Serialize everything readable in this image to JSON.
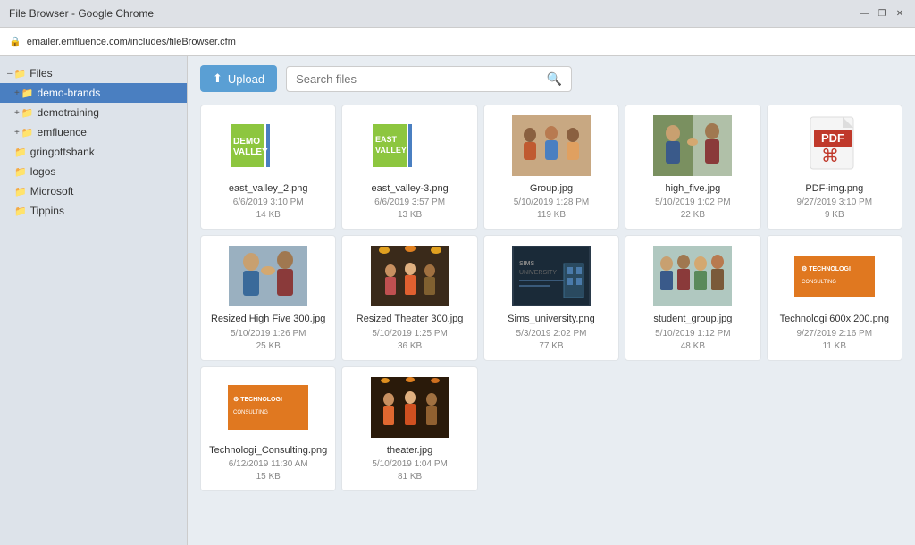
{
  "browser": {
    "title": "File Browser - Google Chrome",
    "url": "emailer.emfluence.com/includes/fileBrowser.cfm",
    "controls": {
      "minimize": "—",
      "maximize": "❐",
      "close": "✕"
    }
  },
  "toolbar": {
    "upload_label": "Upload",
    "search_placeholder": "Search files"
  },
  "sidebar": {
    "root_label": "Files",
    "items": [
      {
        "id": "demo-brands",
        "label": "demo-brands",
        "level": 1,
        "active": true,
        "expanded": false
      },
      {
        "id": "demotraining",
        "label": "demotraining",
        "level": 1,
        "active": false,
        "expanded": false
      },
      {
        "id": "emfluence",
        "label": "emfluence",
        "level": 1,
        "active": false,
        "expanded": false
      },
      {
        "id": "gringottsbank",
        "label": "gringottsbank",
        "level": 1,
        "active": false,
        "expanded": false
      },
      {
        "id": "logos",
        "label": "logos",
        "level": 1,
        "active": false,
        "expanded": false
      },
      {
        "id": "microsoft",
        "label": "Microsoft",
        "level": 1,
        "active": false,
        "expanded": false
      },
      {
        "id": "tippins",
        "label": "Tippins",
        "level": 1,
        "active": false,
        "expanded": false
      }
    ]
  },
  "files": [
    {
      "name": "east_valley_2.png",
      "date": "6/6/2019 3:10 PM",
      "size": "14 KB",
      "type": "image",
      "thumb": "east_valley_2"
    },
    {
      "name": "east_valley-3.png",
      "date": "6/6/2019 3:57 PM",
      "size": "13 KB",
      "type": "image",
      "thumb": "east_valley_3"
    },
    {
      "name": "Group.jpg",
      "date": "5/10/2019 1:28 PM",
      "size": "119 KB",
      "type": "image",
      "thumb": "group"
    },
    {
      "name": "high_five.jpg",
      "date": "5/10/2019 1:02 PM",
      "size": "22 KB",
      "type": "image",
      "thumb": "high_five"
    },
    {
      "name": "PDF-img.png",
      "date": "9/27/2019 3:10 PM",
      "size": "9 KB",
      "type": "pdf",
      "thumb": "pdf"
    },
    {
      "name": "Resized High Five 300.jpg",
      "date": "5/10/2019 1:26 PM",
      "size": "25 KB",
      "type": "image",
      "thumb": "resized_high_five"
    },
    {
      "name": "Resized Theater 300.jpg",
      "date": "5/10/2019 1:25 PM",
      "size": "36 KB",
      "type": "image",
      "thumb": "resized_theater"
    },
    {
      "name": "Sims_university.png",
      "date": "5/3/2019 2:02 PM",
      "size": "77 KB",
      "type": "image",
      "thumb": "sims_university"
    },
    {
      "name": "student_group.jpg",
      "date": "5/10/2019 1:12 PM",
      "size": "48 KB",
      "type": "image",
      "thumb": "student_group"
    },
    {
      "name": "Technologi 600x 200.png",
      "date": "9/27/2019 2:16 PM",
      "size": "11 KB",
      "type": "image",
      "thumb": "technologi_600"
    },
    {
      "name": "Technologi_Consulting.png",
      "date": "6/12/2019 11:30 AM",
      "size": "15 KB",
      "type": "image",
      "thumb": "technologi_consulting"
    },
    {
      "name": "theater.jpg",
      "date": "5/10/2019 1:04 PM",
      "size": "81 KB",
      "type": "image",
      "thumb": "theater"
    }
  ]
}
